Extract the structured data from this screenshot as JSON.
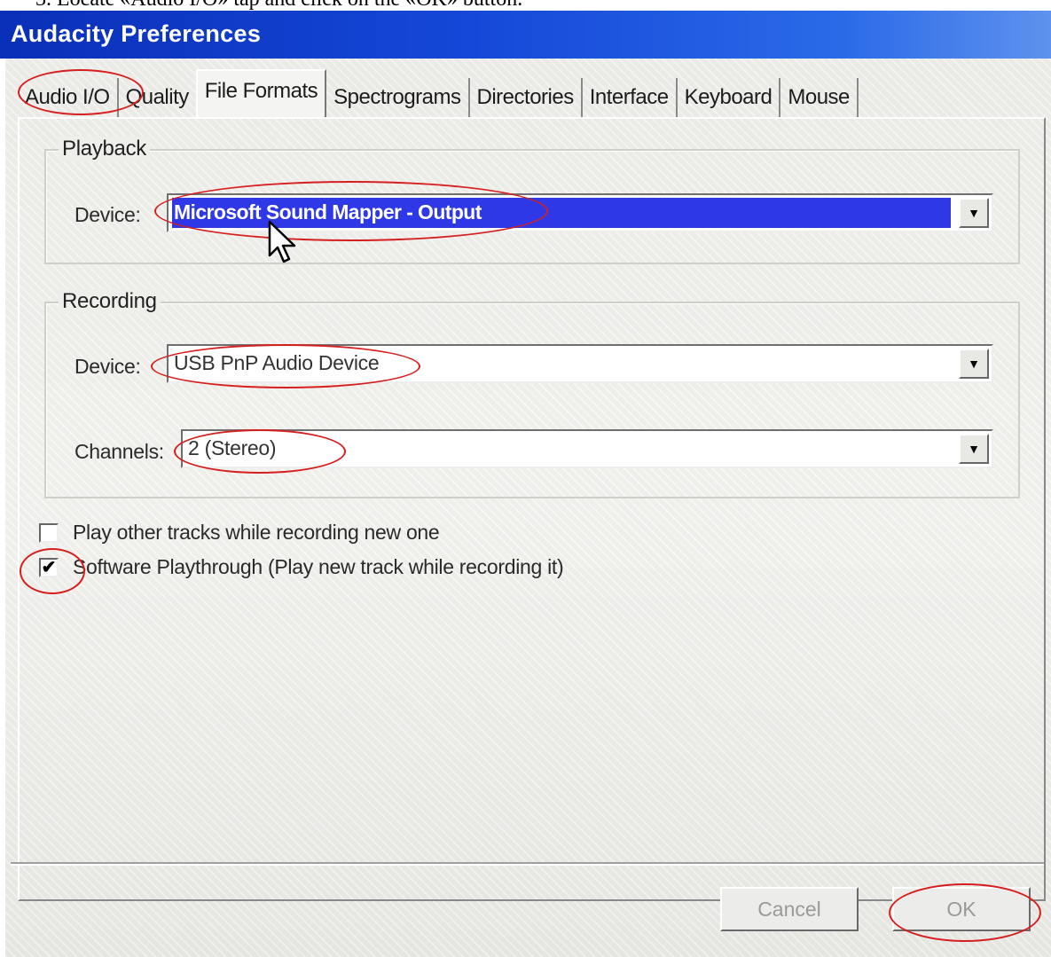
{
  "caption": "3. Locate «Audio I/O» tap and click on the «OK» button.",
  "window": {
    "title": "Audacity Preferences"
  },
  "tabs": [
    {
      "label": "Audio I/O"
    },
    {
      "label": "Quality"
    },
    {
      "label": "File Formats"
    },
    {
      "label": "Spectrograms"
    },
    {
      "label": "Directories"
    },
    {
      "label": "Interface"
    },
    {
      "label": "Keyboard"
    },
    {
      "label": "Mouse"
    }
  ],
  "playback": {
    "legend": "Playback",
    "device_label": "Device:",
    "device_value": "Microsoft Sound Mapper - Output"
  },
  "recording": {
    "legend": "Recording",
    "device_label": "Device:",
    "device_value": "USB PnP Audio Device",
    "channels_label": "Channels:",
    "channels_value": "2 (Stereo)"
  },
  "options": {
    "play_other_tracks": {
      "label": "Play other tracks while recording new one",
      "checked": false
    },
    "software_playthrough": {
      "label": "Software Playthrough (Play new track while recording it)",
      "checked": true
    }
  },
  "buttons": {
    "cancel": "Cancel",
    "ok": "OK"
  },
  "colors": {
    "title_bar": "#1548d8",
    "selection": "#2f38e6",
    "annotation": "#d61f1f"
  }
}
